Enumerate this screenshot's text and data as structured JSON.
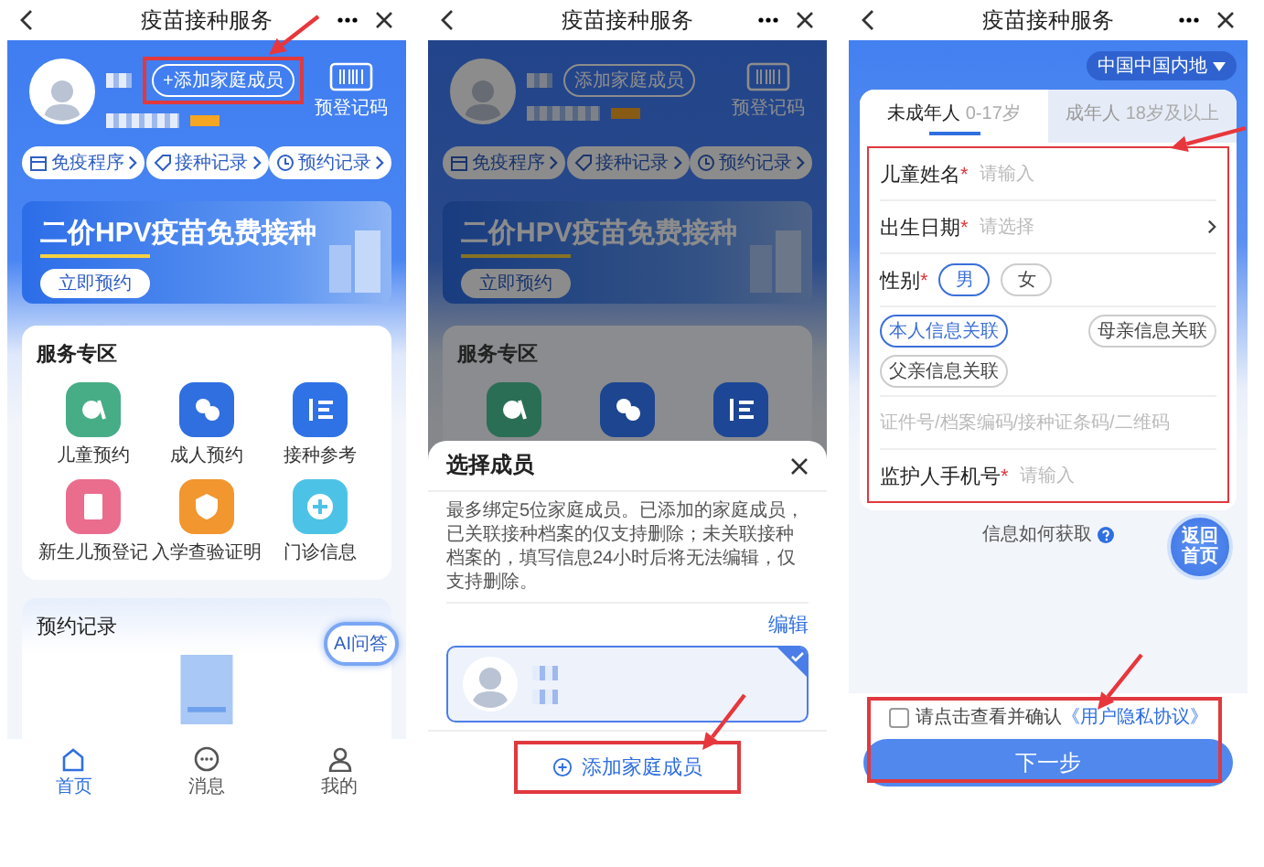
{
  "panels": [
    {
      "kind": "home",
      "header": {
        "title": "疫苗接种服务"
      },
      "home": {
        "add_member": "+添加家庭成员",
        "code_label": "预登记码",
        "quick_links": [
          "免疫程序",
          "接种记录",
          "预约记录"
        ],
        "banner": {
          "title": "二价HPV疫苗免费接种",
          "button": "立即预约"
        },
        "services": {
          "title": "服务专区",
          "items": [
            {
              "label": "儿童预约",
              "color": "#46ad86"
            },
            {
              "label": "成人预约",
              "color": "#2f6fe0"
            },
            {
              "label": "接种参考",
              "color": "#2f72e6"
            },
            {
              "label": "新生儿预登记",
              "color": "#ea6d8e"
            },
            {
              "label": "入学查验证明",
              "color": "#f2962f"
            },
            {
              "label": "门诊信息",
              "color": "#4cc3e6"
            }
          ]
        },
        "records": {
          "title": "预约记录"
        },
        "ai_button": "AI问答",
        "nav": [
          {
            "label": "首页",
            "selected": true
          },
          {
            "label": "消息",
            "selected": false
          },
          {
            "label": "我的",
            "selected": false
          }
        ]
      }
    },
    {
      "kind": "member_picker",
      "header": {
        "title": "疫苗接种服务"
      },
      "home": {
        "add_member": "添加家庭成员",
        "code_label": "预登记码",
        "quick_links": [
          "免疫程序",
          "接种记录",
          "预约记录"
        ],
        "banner": {
          "title": "二价HPV疫苗免费接种",
          "button": "立即预约"
        },
        "services": {
          "title": "服务专区",
          "items": [
            {
              "color": "#2a6e55"
            },
            {
              "color": "#1d4590"
            },
            {
              "color": "#1d4796"
            }
          ]
        }
      },
      "sheet": {
        "title": "选择成员",
        "notice": "最多绑定5位家庭成员。已添加的家庭成员，已关联接种档案的仅支持删除；未关联接种档案的，填写信息24小时后将无法编辑，仅支持删除。",
        "edit": "编辑",
        "members": [
          {
            "selected": true
          }
        ],
        "add_button": "添加家庭成员"
      }
    },
    {
      "kind": "registration",
      "header": {
        "title": "疫苗接种服务"
      },
      "region": "中国中国内地",
      "tabs": [
        {
          "label": "未成年人",
          "hint": "0-17岁",
          "selected": true
        },
        {
          "label": "成年人",
          "hint": "18岁及以上",
          "selected": false
        }
      ],
      "fields": [
        {
          "kind": "text",
          "label": "儿童姓名",
          "mark": "*",
          "placeholder": "请输入"
        },
        {
          "kind": "select",
          "label": "出生日期",
          "mark": "*",
          "placeholder": "请选择"
        },
        {
          "kind": "choice",
          "label": "性别",
          "mark": "*",
          "options": [
            {
              "label": "男",
              "selected": true
            },
            {
              "label": "女",
              "selected": false
            }
          ]
        },
        {
          "kind": "chips",
          "options": [
            {
              "label": "本人信息关联",
              "selected": true
            },
            {
              "label": "母亲信息关联",
              "selected": false
            },
            {
              "label": "父亲信息关联",
              "selected": false
            }
          ]
        },
        {
          "kind": "text",
          "placeholder": "证件号/档案编码/接种证条码/二维码"
        },
        {
          "kind": "text",
          "label": "监护人手机号",
          "mark": "*",
          "placeholder": "请输入"
        }
      ],
      "help_link": "信息如何获取",
      "home_button": "返回首页",
      "agreement": {
        "checked": false,
        "text": "请点击查看并确认",
        "link": "《用户隐私协议》"
      },
      "next_button": "下一步"
    }
  ]
}
